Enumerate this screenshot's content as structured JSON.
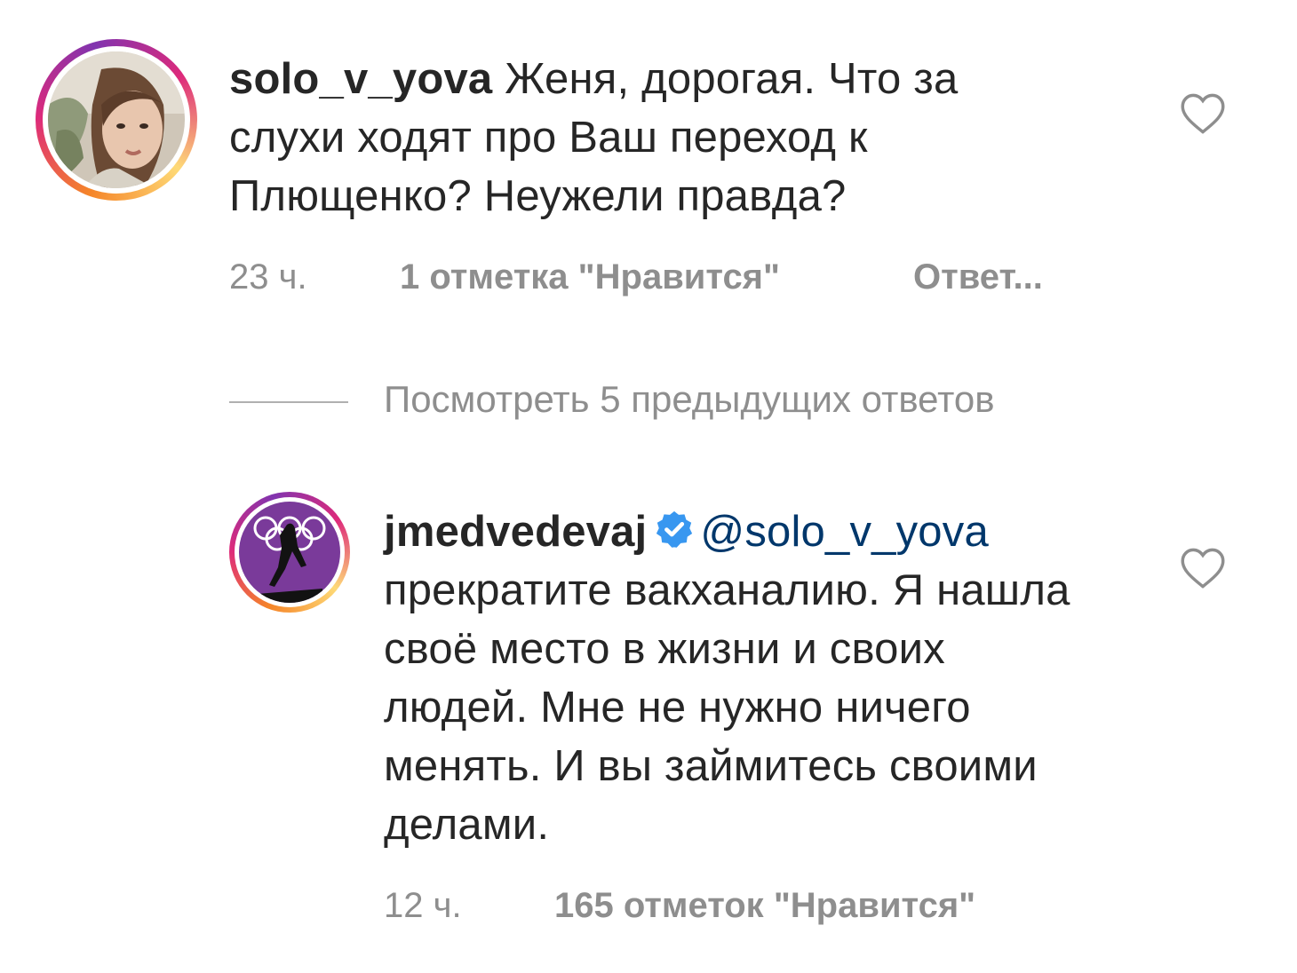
{
  "comments": [
    {
      "username": "solo_v_yova",
      "text": " Женя, дорогая. Что за слухи ходят про Ваш переход к Плющенко? Неужели правда?",
      "time": "23 ч.",
      "likes": "1 отметка \"Нравится\"",
      "reply": "Ответ..."
    },
    {
      "username": "jmedvedevaj",
      "mention": "@solo_v_yova",
      "text": "прекратите вакханалию. Я нашла своё место в жизни и своих людей. Мне не нужно ничего менять. И вы займитесь своими делами.",
      "time": "12 ч.",
      "likes": "165 отметок \"Нравится\""
    }
  ],
  "thread": {
    "view_replies": "Посмотреть 5 предыдущих ответов"
  },
  "icons": {
    "like": "heart-outline-icon",
    "verified": "verified-badge-icon"
  },
  "colors": {
    "text": "#262626",
    "secondary": "#8e8e8e",
    "mention": "#00376b",
    "verified": "#3897f0"
  }
}
